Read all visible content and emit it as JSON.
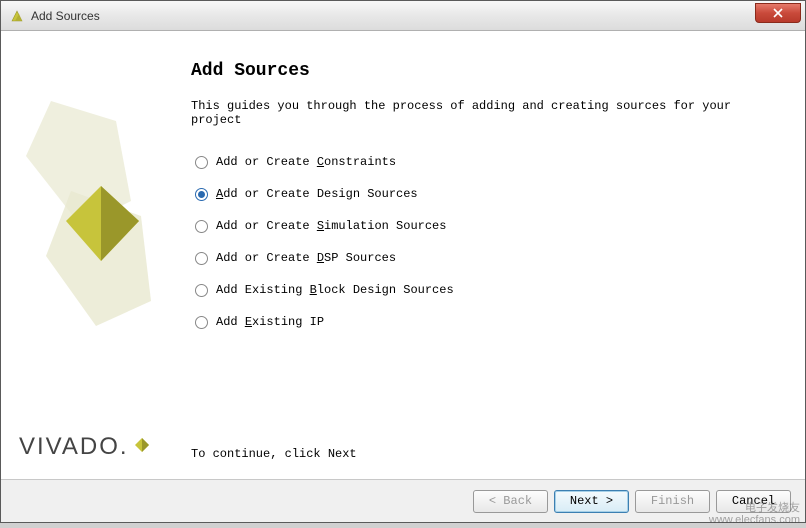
{
  "window": {
    "title": "Add Sources"
  },
  "main": {
    "heading": "Add Sources",
    "description": "This guides you through the process of adding and creating sources for your project",
    "footer_hint": "To continue, click Next"
  },
  "options": [
    {
      "label_pre": "Add or Create ",
      "mnemonic": "C",
      "label_post": "onstraints",
      "selected": false
    },
    {
      "label_pre": "",
      "mnemonic": "A",
      "label_post": "dd or Create Design Sources",
      "selected": true
    },
    {
      "label_pre": "Add or Create ",
      "mnemonic": "S",
      "label_post": "imulation Sources",
      "selected": false
    },
    {
      "label_pre": "Add or Create ",
      "mnemonic": "D",
      "label_post": "SP Sources",
      "selected": false
    },
    {
      "label_pre": "Add Existing ",
      "mnemonic": "B",
      "label_post": "lock Design Sources",
      "selected": false
    },
    {
      "label_pre": "Add ",
      "mnemonic": "E",
      "label_post": "xisting IP",
      "selected": false
    }
  ],
  "buttons": {
    "back": "< Back",
    "next": "Next >",
    "finish": "Finish",
    "cancel": "Cancel"
  },
  "branding": {
    "logo_text": "VIVADO."
  },
  "watermark": {
    "line1": "电子发烧友",
    "line2": "www.elecfans.com"
  }
}
